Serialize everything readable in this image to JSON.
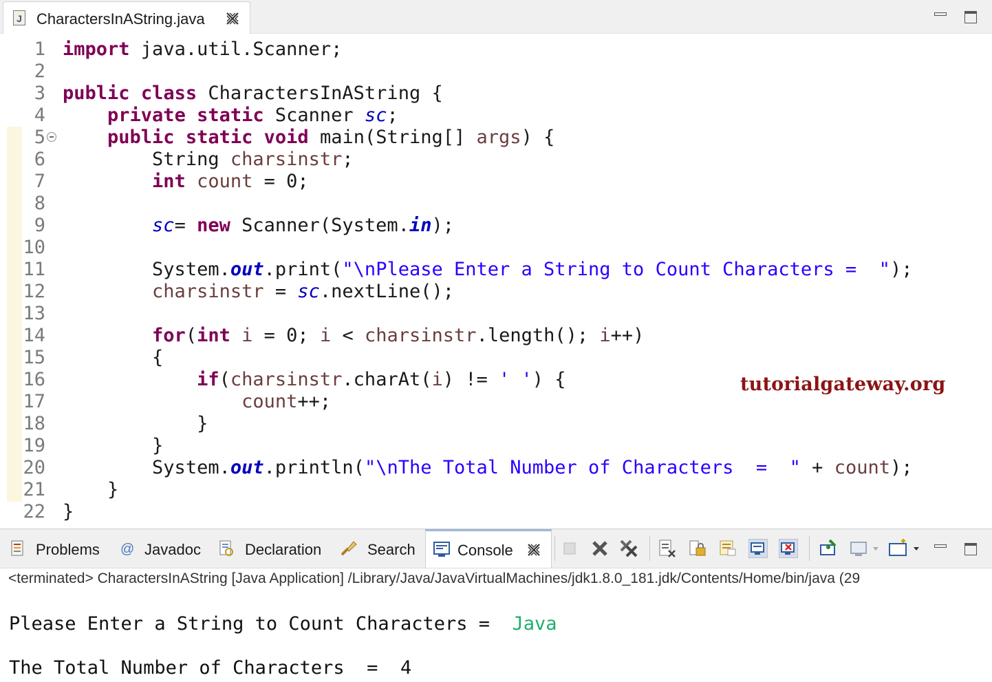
{
  "editor_tab": {
    "title": "CharactersInAString.java",
    "icon_letter": "J"
  },
  "line_numbers": [
    "1",
    "2",
    "3",
    "4",
    "5",
    "6",
    "7",
    "8",
    "9",
    "10",
    "11",
    "12",
    "13",
    "14",
    "15",
    "16",
    "17",
    "18",
    "19",
    "20",
    "21",
    "22"
  ],
  "code": {
    "l1": {
      "kw": "import",
      "rest": " java.util.Scanner;"
    },
    "l3": {
      "kw1": "public",
      "kw2": "class",
      "rest": " CharactersInAString {"
    },
    "l4": {
      "indent": "    ",
      "kw1": "private",
      "kw2": "static",
      "type": " Scanner ",
      "field": "sc",
      "end": ";"
    },
    "l5": {
      "indent": "    ",
      "kw1": "public",
      "kw2": "static",
      "kw3": "void",
      "rest": " main(String[] ",
      "param": "args",
      "end": ") {"
    },
    "l6": {
      "indent": "        ",
      "type": "String ",
      "var": "charsinstr",
      "end": ";"
    },
    "l7": {
      "indent": "        ",
      "kw": "int",
      "sp": " ",
      "var": "count",
      "rest": " = 0;"
    },
    "l9": {
      "indent": "        ",
      "field": "sc",
      "eq": "= ",
      "kw": "new",
      "mid": " Scanner(System.",
      "sfield": "in",
      "end": ");"
    },
    "l11": {
      "indent": "        ",
      "pre": "System.",
      "sfield": "out",
      "mid": ".print(",
      "str": "\"\\nPlease Enter a String to Count Characters =  \"",
      "end": ");"
    },
    "l12": {
      "indent": "        ",
      "var": "charsinstr",
      "mid": " = ",
      "field": "sc",
      "end": ".nextLine();"
    },
    "l14": {
      "indent": "        ",
      "kw1": "for",
      "p1": "(",
      "kw2": "int",
      "sp": " ",
      "v1": "i",
      "t1": " = 0; ",
      "v2": "i",
      "t2": " < ",
      "v3": "charsinstr",
      "t3": ".length(); ",
      "v4": "i",
      "t4": "++)"
    },
    "l15": {
      "indent": "        ",
      "text": "{"
    },
    "l16": {
      "indent": "            ",
      "kw": "if",
      "p1": "(",
      "v1": "charsinstr",
      "t1": ".charAt(",
      "v2": "i",
      "t2": ") != ",
      "str": "' '",
      "end": ") {"
    },
    "l17": {
      "indent": "                ",
      "var": "count",
      "end": "++;"
    },
    "l18": {
      "indent": "            ",
      "text": "}"
    },
    "l19": {
      "indent": "        ",
      "text": "}"
    },
    "l20": {
      "indent": "        ",
      "pre": "System.",
      "sfield": "out",
      "mid": ".println(",
      "str": "\"\\nThe Total Number of Characters  =  \"",
      "plus": " + ",
      "var": "count",
      "end": ");"
    },
    "l21": {
      "indent": "    ",
      "text": "}"
    },
    "l22": {
      "text": "}"
    }
  },
  "watermark": "tutorialgateway.org",
  "bottom_tabs": {
    "problems": "Problems",
    "javadoc": "Javadoc",
    "declaration": "Declaration",
    "search": "Search",
    "console": "Console"
  },
  "console": {
    "status": "<terminated> CharactersInAString [Java Application] /Library/Java/JavaVirtualMachines/jdk1.8.0_181.jdk/Contents/Home/bin/java  (29",
    "prompt": "Please Enter a String to Count Characters =  ",
    "user_input": "Java",
    "result": "The Total Number of Characters  =  4"
  },
  "colors": {
    "keyword": "#7f0055",
    "string": "#2a00ff",
    "local_variable": "#6a3e3e",
    "field": "#0000c0",
    "user_input": "#1fae6b",
    "watermark": "#8b1414"
  },
  "icons": {
    "editor": [
      "java-file-icon",
      "close-icon",
      "minimize-icon",
      "maximize-icon"
    ],
    "console_toolbar": [
      "terminate-icon",
      "remove-launch-icon",
      "remove-all-terminated-icon",
      "clear-console-icon",
      "scroll-lock-icon",
      "word-wrap-icon",
      "show-on-stdout-icon",
      "show-on-stderr-icon",
      "pin-console-icon",
      "display-console-icon",
      "open-console-icon",
      "minimize-icon",
      "maximize-icon"
    ]
  }
}
